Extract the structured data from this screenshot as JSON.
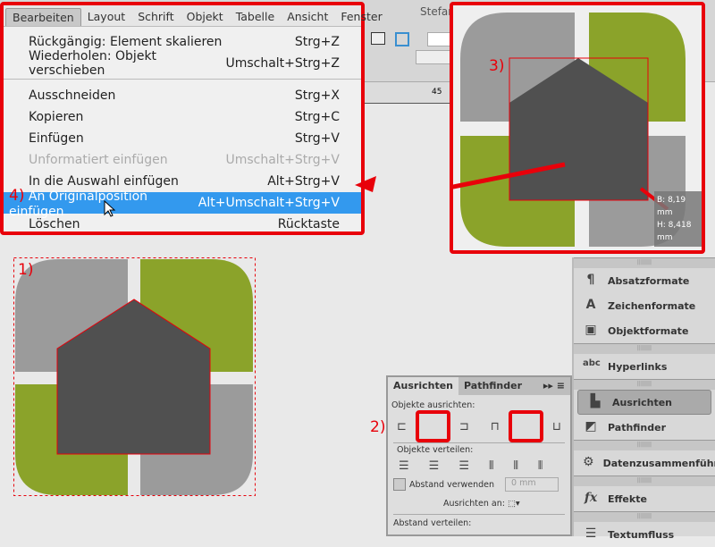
{
  "menu": {
    "bar": [
      "Bearbeiten",
      "Layout",
      "Schrift",
      "Objekt",
      "Tabelle",
      "Ansicht",
      "Fenster"
    ],
    "items": [
      {
        "label": "Rückgängig: Element skalieren",
        "shortcut": "Strg+Z"
      },
      {
        "label": "Wiederholen: Objekt verschieben",
        "shortcut": "Umschalt+Strg+Z"
      },
      {
        "label": "Ausschneiden",
        "shortcut": "Strg+X"
      },
      {
        "label": "Kopieren",
        "shortcut": "Strg+C"
      },
      {
        "label": "Einfügen",
        "shortcut": "Strg+V"
      },
      {
        "label": "Unformatiert einfügen",
        "shortcut": "Umschalt+Strg+V"
      },
      {
        "label": "In die Auswahl einfügen",
        "shortcut": "Alt+Strg+V"
      },
      {
        "label": "An Originalposition einfügen",
        "shortcut": "Alt+Umschalt+Strg+V"
      },
      {
        "label": "Löschen",
        "shortcut": "Rücktaste"
      }
    ]
  },
  "steps": {
    "s1": "1)",
    "s2": "2)",
    "s3": "3)",
    "s4": "4)"
  },
  "toolbar": {
    "user": "Stefan",
    "ruler_mark": "45"
  },
  "tooltip": {
    "w": "B: 8,19 mm",
    "h": "H: 8,418 mm"
  },
  "panel": {
    "items": [
      "Absatzformate",
      "Zeichenformate",
      "Objektformate",
      "Hyperlinks",
      "Ausrichten",
      "Pathfinder",
      "Datenzusammenführung",
      "Effekte",
      "Textumfluss"
    ]
  },
  "align": {
    "tab1": "Ausrichten",
    "tab2": "Pathfinder",
    "objects_align": "Objekte ausrichten:",
    "objects_distribute": "Objekte verteilen:",
    "use_spacing": "Abstand verwenden",
    "spacing_value": "0 mm",
    "align_to": "Ausrichten an:",
    "distribute_spacing": "Abstand verteilen:"
  },
  "colors": {
    "green": "#8ba32a",
    "gray": "#9b9b9b",
    "dark": "#505050",
    "red": "#e8000a",
    "highlight": "#3399ee"
  }
}
